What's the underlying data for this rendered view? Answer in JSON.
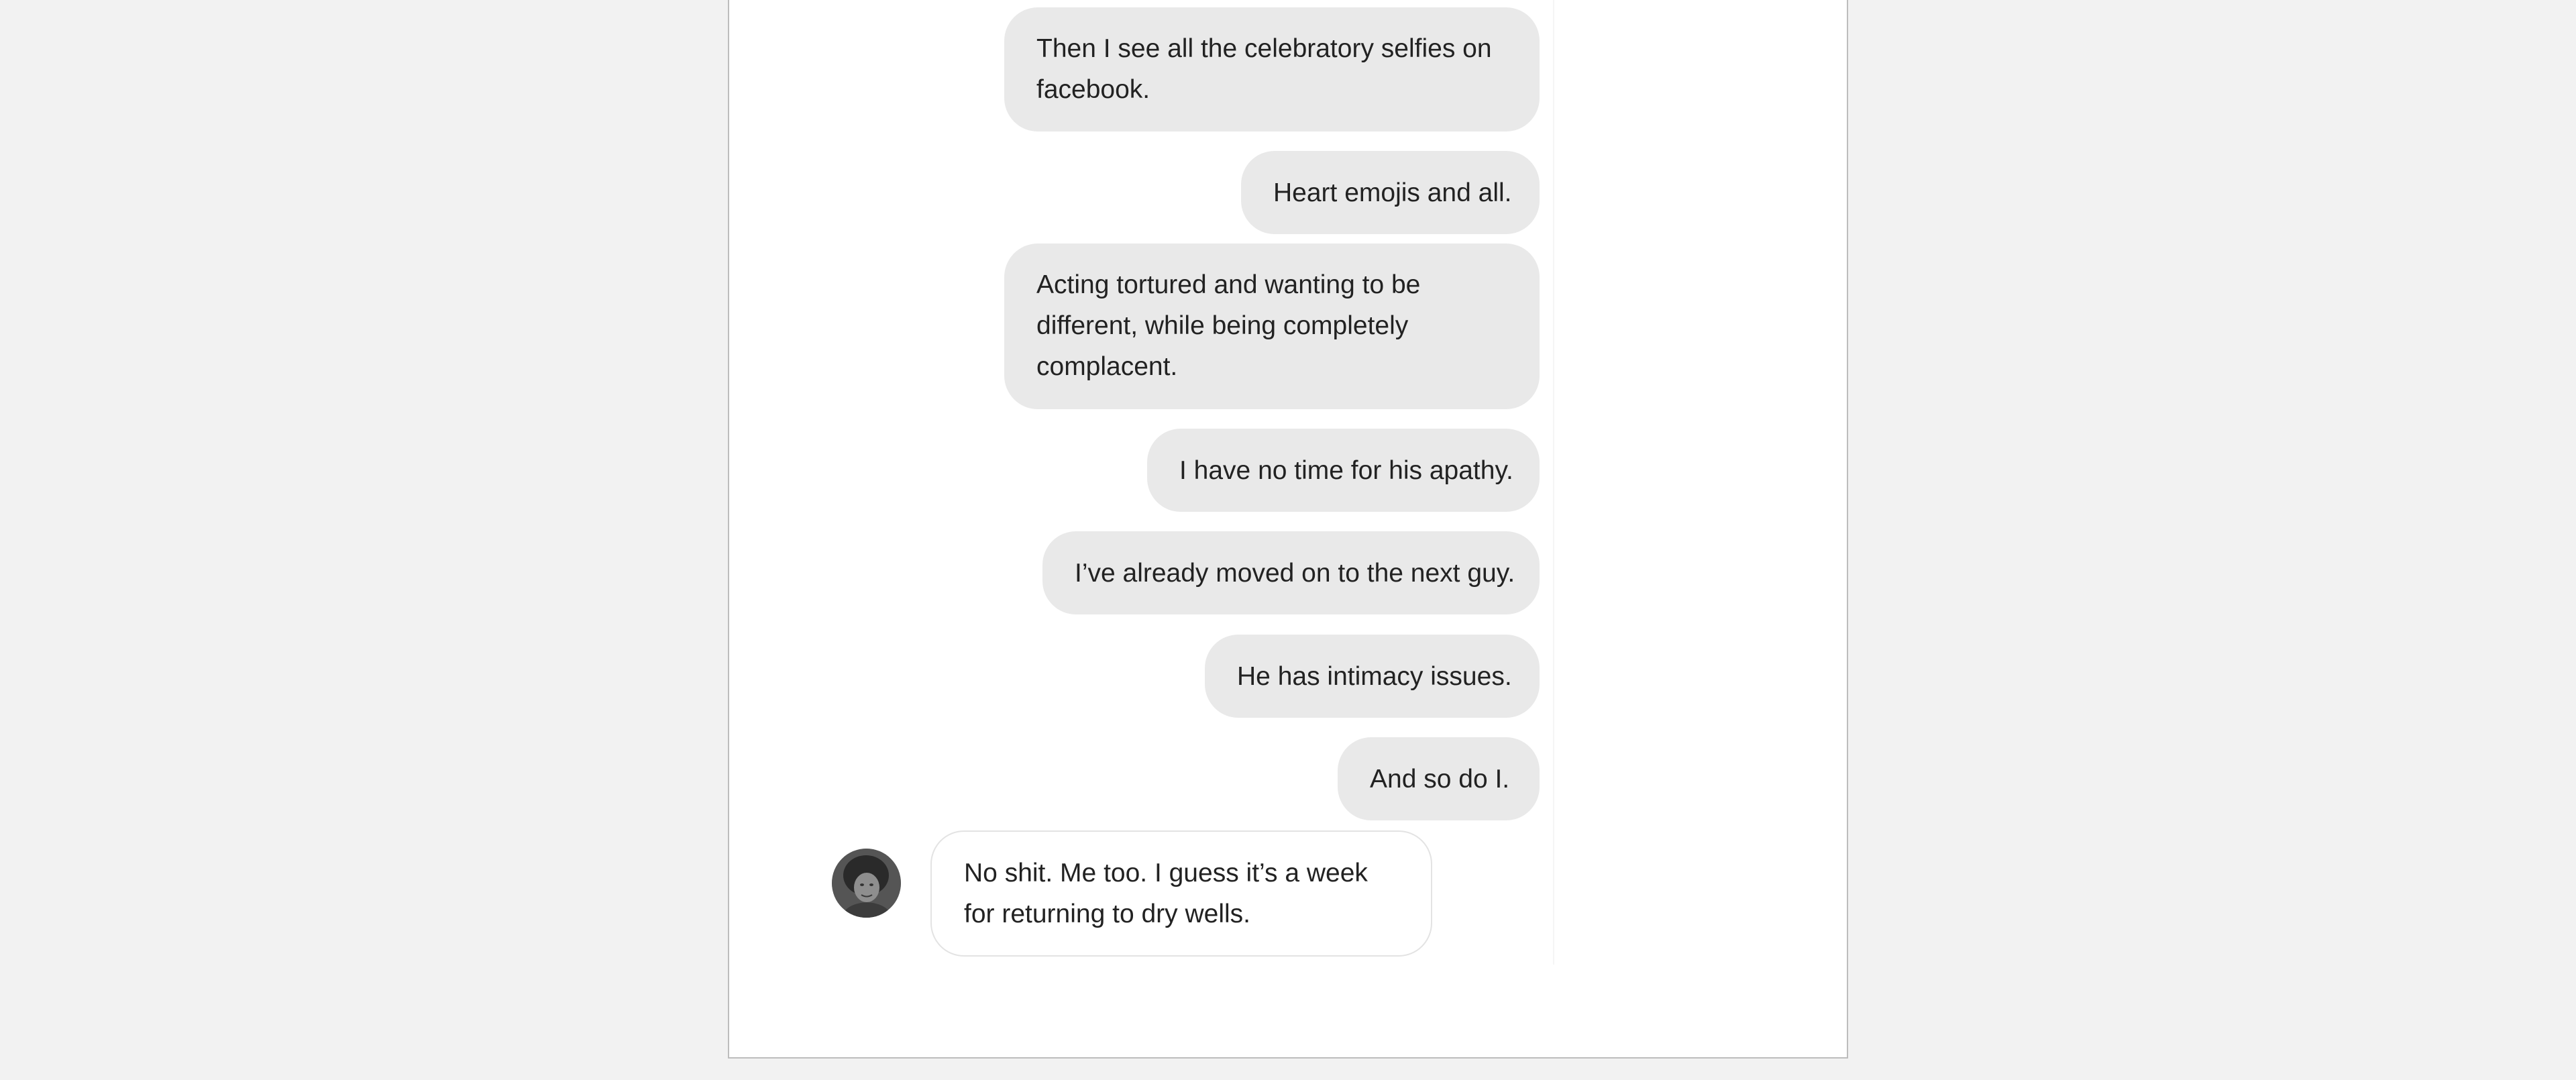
{
  "conversation": {
    "messages": [
      {
        "direction": "sent",
        "text": "Then I see all the celebratory selfies on facebook."
      },
      {
        "direction": "sent",
        "text": "Heart emojis and all."
      },
      {
        "direction": "sent",
        "text": "Acting tortured and wanting to be different, while being completely complacent."
      },
      {
        "direction": "sent",
        "text": "I have no time for his apathy."
      },
      {
        "direction": "sent",
        "text": "I’ve already moved on to the next guy."
      },
      {
        "direction": "sent",
        "text": "He has intimacy issues."
      },
      {
        "direction": "sent",
        "text": "And so do I."
      },
      {
        "direction": "received",
        "text": "No shit. Me too. I guess it’s a week for returning to dry wells."
      }
    ],
    "avatar": {
      "icon": "person-avatar-photo"
    },
    "colors": {
      "sent_bubble": "#e9e9e9",
      "received_bubble_border": "#e3e3e3",
      "page_background": "#f2f2f2",
      "text": "#222222"
    }
  }
}
